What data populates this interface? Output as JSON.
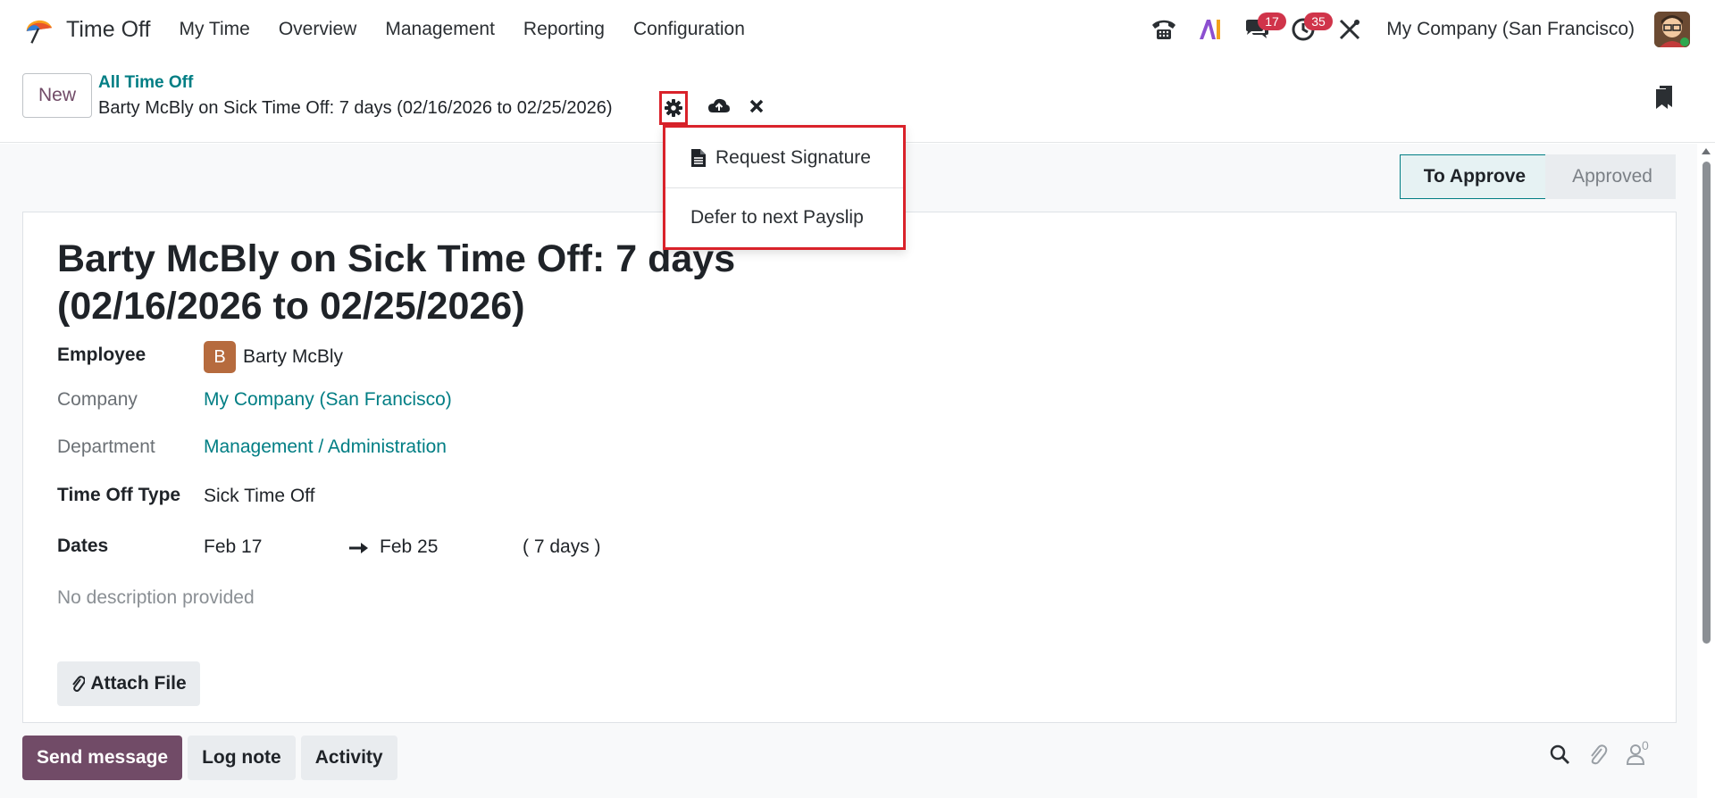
{
  "topnav": {
    "app_name": "Time Off",
    "menu": [
      "My Time",
      "Overview",
      "Management",
      "Reporting",
      "Configuration"
    ],
    "chat_badge": "17",
    "activity_badge": "35",
    "company": "My Company (San Francisco)"
  },
  "control": {
    "new_label": "New",
    "breadcrumb_parent": "All Time Off",
    "breadcrumb_current": "Barty McBly on Sick Time Off: 7 days (02/16/2026 to 02/25/2026)"
  },
  "action_menu": {
    "items": [
      {
        "label": "Request Signature",
        "icon": "file-icon"
      },
      {
        "label": "Defer to next Payslip"
      }
    ]
  },
  "status": {
    "stages": [
      "To Approve",
      "Approved"
    ],
    "active": "To Approve"
  },
  "form": {
    "title": "Barty McBly on Sick Time Off: 7 days (02/16/2026 to 02/25/2026)",
    "employee_label": "Employee",
    "employee_initial": "B",
    "employee_name": "Barty McBly",
    "company_label": "Company",
    "company_value": "My Company (San Francisco)",
    "department_label": "Department",
    "department_value": "Management / Administration",
    "type_label": "Time Off Type",
    "type_value": "Sick Time Off",
    "dates_label": "Dates",
    "date_from": "Feb 17",
    "date_to": "Feb 25",
    "duration": "( 7 days )",
    "description_placeholder": "No description provided",
    "attach_label": "Attach File"
  },
  "chatter": {
    "send_message": "Send message",
    "log_note": "Log note",
    "activity": "Activity",
    "followers_count": "0"
  },
  "colors": {
    "brand": "#714b67",
    "link": "#017e84",
    "highlight": "#d9222a"
  }
}
